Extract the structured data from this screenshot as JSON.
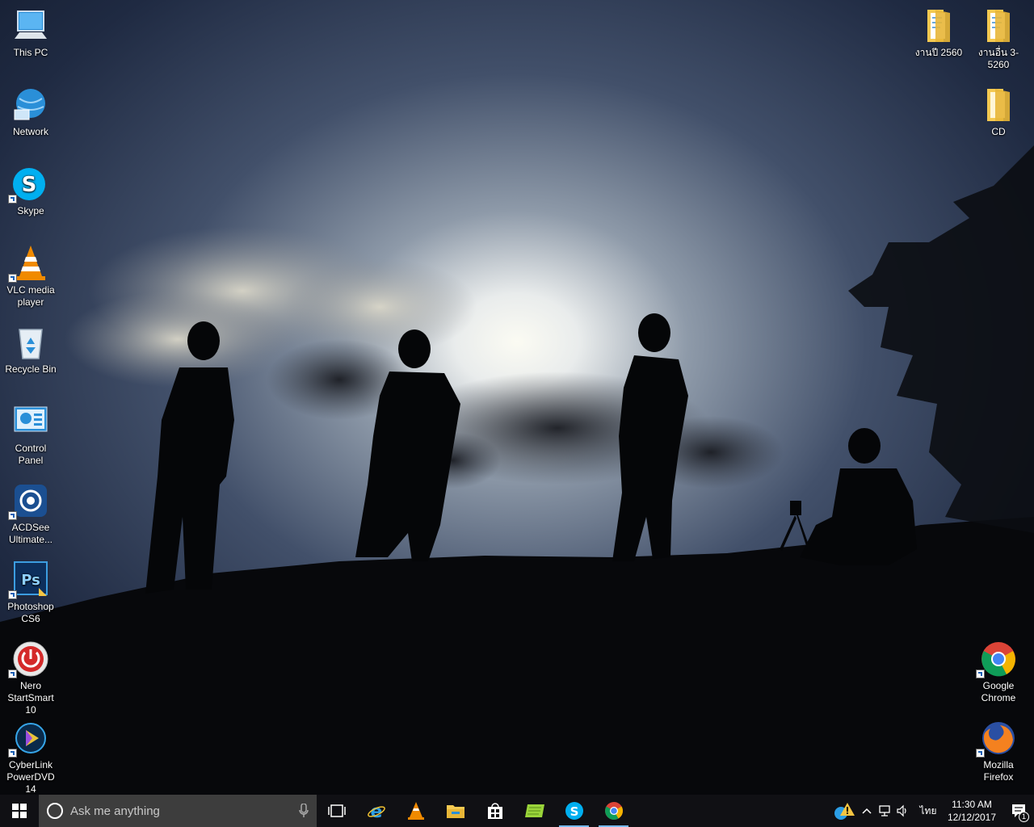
{
  "desktop_icons_left": [
    {
      "label": "This PC",
      "icon": "this-pc-icon"
    },
    {
      "label": "Network",
      "icon": "network-icon"
    },
    {
      "label": "Skype",
      "icon": "skype-icon"
    },
    {
      "label": "VLC media player",
      "icon": "vlc-icon"
    },
    {
      "label": "Recycle Bin",
      "icon": "recycle-bin-icon"
    },
    {
      "label": "Control Panel",
      "icon": "control-panel-icon"
    },
    {
      "label": "ACDSee Ultimate...",
      "icon": "acdsee-icon"
    },
    {
      "label": "Photoshop CS6",
      "icon": "photoshop-icon"
    },
    {
      "label": "Nero StartSmart 10",
      "icon": "nero-icon"
    },
    {
      "label": "CyberLink PowerDVD 14",
      "icon": "powerdvd-icon"
    }
  ],
  "desktop_icons_right": [
    {
      "label": "งานปี 2560",
      "icon": "folder-icon"
    },
    {
      "label": "งานอื่น 3-5260",
      "icon": "folder-icon"
    },
    {
      "label": "CD",
      "icon": "folder-icon"
    },
    {
      "label": "Google Chrome",
      "icon": "chrome-icon"
    },
    {
      "label": "Mozilla Firefox",
      "icon": "firefox-icon"
    }
  ],
  "taskbar": {
    "search_placeholder": "Ask me anything",
    "pinned": [
      "task-view",
      "internet-explorer",
      "vlc",
      "file-explorer",
      "store",
      "notepad",
      "skype",
      "chrome"
    ],
    "running": [
      "skype",
      "chrome"
    ],
    "language": "ไทย",
    "time": "11:30 AM",
    "date": "12/12/2017",
    "notification_count": "1"
  },
  "colors": {
    "taskbar": "#101014",
    "search_box": "#3d3d3d",
    "running_indicator": "#76b9ed"
  }
}
